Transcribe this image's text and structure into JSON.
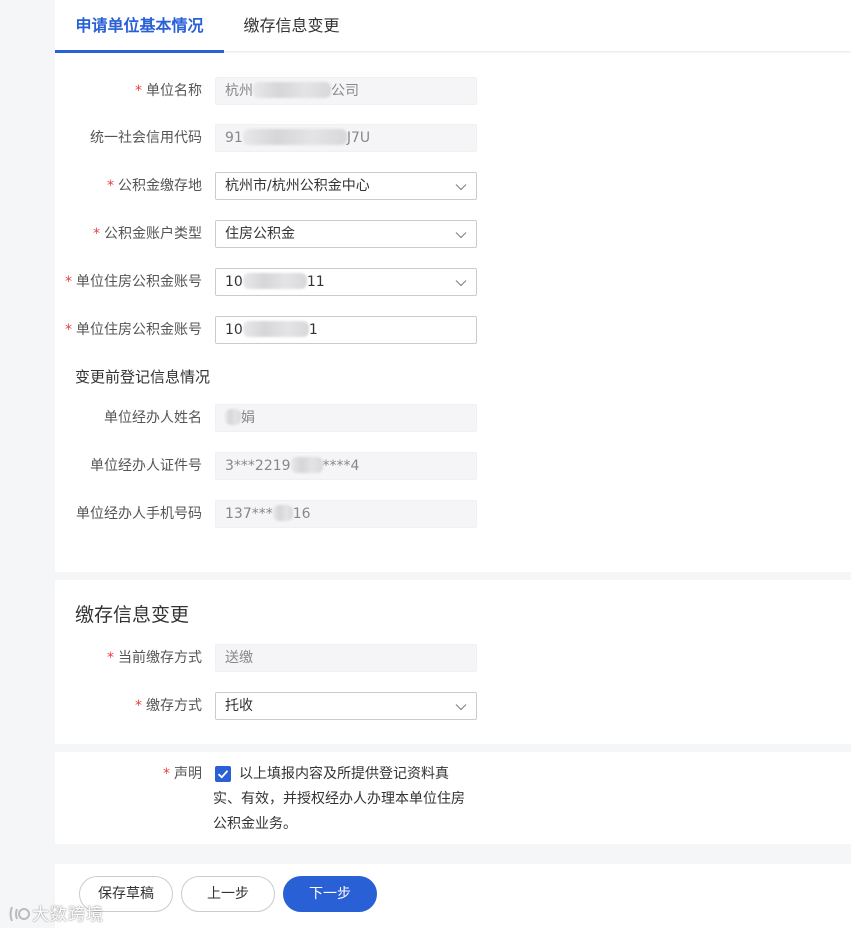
{
  "tabs": [
    {
      "label": "申请单位基本情况",
      "active": true
    },
    {
      "label": "缴存信息变更",
      "active": false
    }
  ],
  "form": {
    "unit_name": {
      "label": "单位名称",
      "required": true,
      "value_start": "杭州",
      "value_end": "公司"
    },
    "credit_code": {
      "label": "统一社会信用代码",
      "required": false,
      "value_start": "91",
      "value_end": "J7U"
    },
    "deposit_place": {
      "label": "公积金缴存地",
      "required": true,
      "value": "杭州市/杭州公积金中心"
    },
    "account_type": {
      "label": "公积金账户类型",
      "required": true,
      "value": "住房公积金"
    },
    "account_no_select": {
      "label": "单位住房公积金账号",
      "required": true,
      "value_start": "10",
      "value_end": "11"
    },
    "account_no_input": {
      "label": "单位住房公积金账号",
      "required": true,
      "value_start": "10",
      "value_end": "1"
    }
  },
  "before_change": {
    "title": "变更前登记信息情况",
    "agent_name": {
      "label": "单位经办人姓名",
      "value_end": "娟"
    },
    "agent_id": {
      "label": "单位经办人证件号",
      "value_start": "3***2219",
      "value_end": "****4"
    },
    "agent_phone": {
      "label": "单位经办人手机号码",
      "value_start": "137***",
      "value_end": "16"
    }
  },
  "change": {
    "title": "缴存信息变更",
    "current_method": {
      "label": "当前缴存方式",
      "required": true,
      "value": "送缴"
    },
    "method": {
      "label": "缴存方式",
      "required": true,
      "value": "托收"
    }
  },
  "declaration": {
    "label": "声明",
    "required": true,
    "checked": true,
    "text": "以上填报内容及所提供登记资料真实、有效，并授权经办人办理本单位住房公积金业务。"
  },
  "buttons": {
    "save_draft": "保存草稿",
    "prev": "上一步",
    "next": "下一步"
  },
  "watermark": "大数跨境",
  "icons": {
    "chevron": "chevron-down-icon",
    "check": "checkmark-icon"
  },
  "colors": {
    "primary": "#2a60d6",
    "required": "#e64340"
  }
}
